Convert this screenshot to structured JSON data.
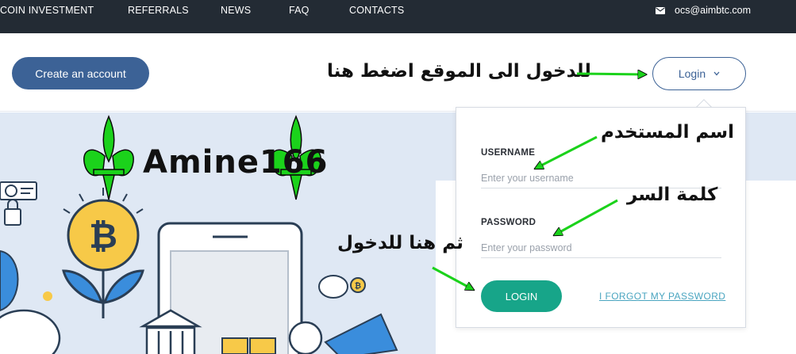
{
  "nav": {
    "items": [
      "COIN INVESTMENT",
      "REFERRALS",
      "NEWS",
      "FAQ",
      "CONTACTS"
    ],
    "email": "ocs@aimbtc.com",
    "email_icon": "envelope-icon"
  },
  "header": {
    "create_account": "Create an account",
    "login": "Login",
    "annotation": "للدخول الى الموقع اضغط هنا"
  },
  "hero": {
    "watermark": "Amine166"
  },
  "login_panel": {
    "username_label": "USERNAME",
    "username_placeholder": "Enter your username",
    "username_annotation": "اسم المستخدم",
    "password_label": "PASSWORD",
    "password_placeholder": "Enter your password",
    "password_annotation": "كلمة السر",
    "submit_annotation": "ثم هنا للدخول",
    "submit": "LOGIN",
    "forgot": "I FORGOT MY PASSWORD"
  },
  "colors": {
    "nav_bg": "#232b34",
    "primary": "#3c6296",
    "success": "#17a589",
    "link": "#4aa5c0",
    "arrow": "#1bd21b",
    "hero_bg": "#dfe8f4"
  }
}
